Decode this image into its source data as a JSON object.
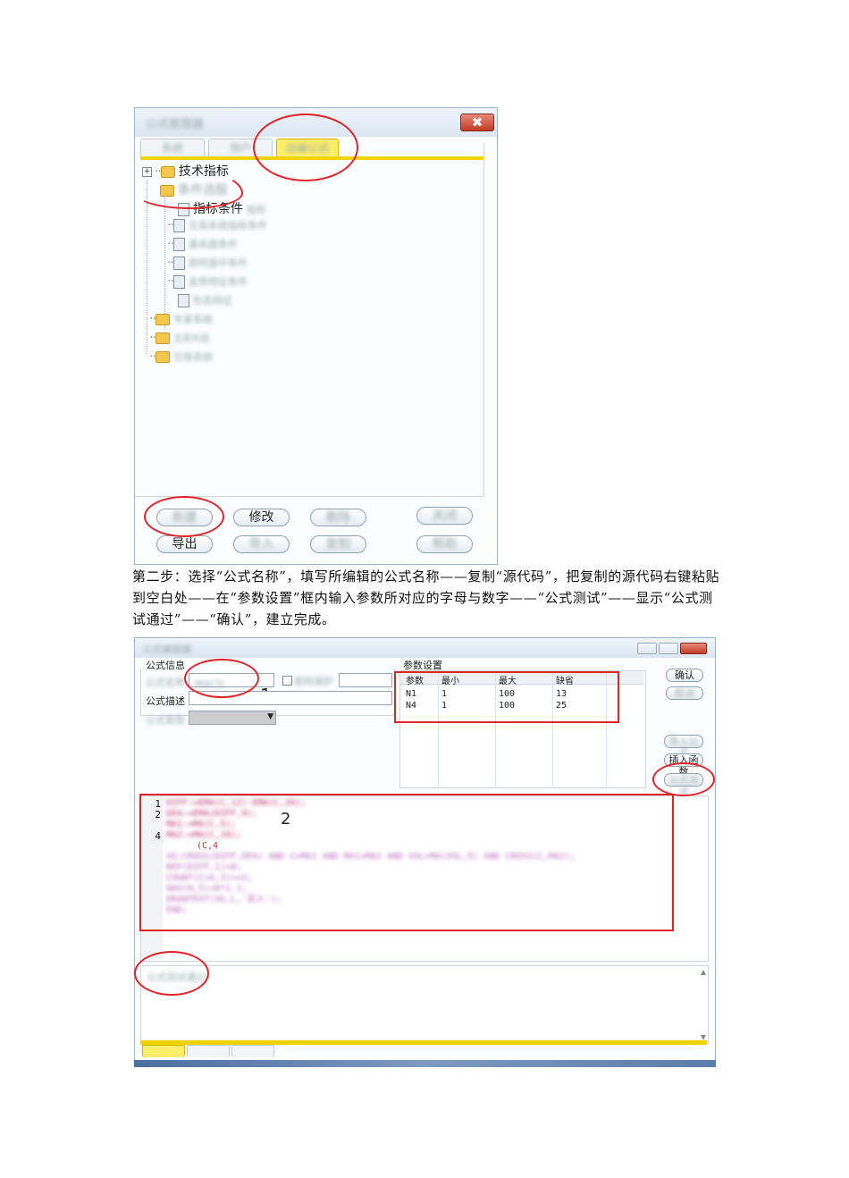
{
  "screenshot1": {
    "close_symbol": "✖",
    "tree": {
      "root_label": "技术指标",
      "child_label": "指标条件"
    },
    "buttons": {
      "modify": "修改",
      "export": "导出"
    }
  },
  "paragraph": "第二步：选择“公式名称”，填写所编辑的公式名称——复制“源代码”，把复制的源代码右键粘贴到空白处——在“参数设置”框内输入参数所对应的字母与数字——“公式测试”——显示“公式测试通过”——“确认”，建立完成。",
  "screenshot2": {
    "formula_info_label": "公式信息",
    "formula_desc_label": "公式描述",
    "annotation_1": "1",
    "annotation_2": "2",
    "param_settings": {
      "title": "参数设置",
      "headers": [
        "参数",
        "最小",
        "最大",
        "缺省"
      ],
      "rows": [
        [
          "N1",
          "1",
          "100",
          "13"
        ],
        [
          "N4",
          "1",
          "100",
          "25"
        ]
      ]
    },
    "buttons": {
      "confirm": "确认",
      "insert_func": "插入函数"
    },
    "code_line_numbers": [
      "1",
      "2",
      "4"
    ],
    "code_fragment": "(C,4"
  },
  "colors": {
    "annotation_red": "#e0242a",
    "tab_yellow": "#f0d400"
  }
}
